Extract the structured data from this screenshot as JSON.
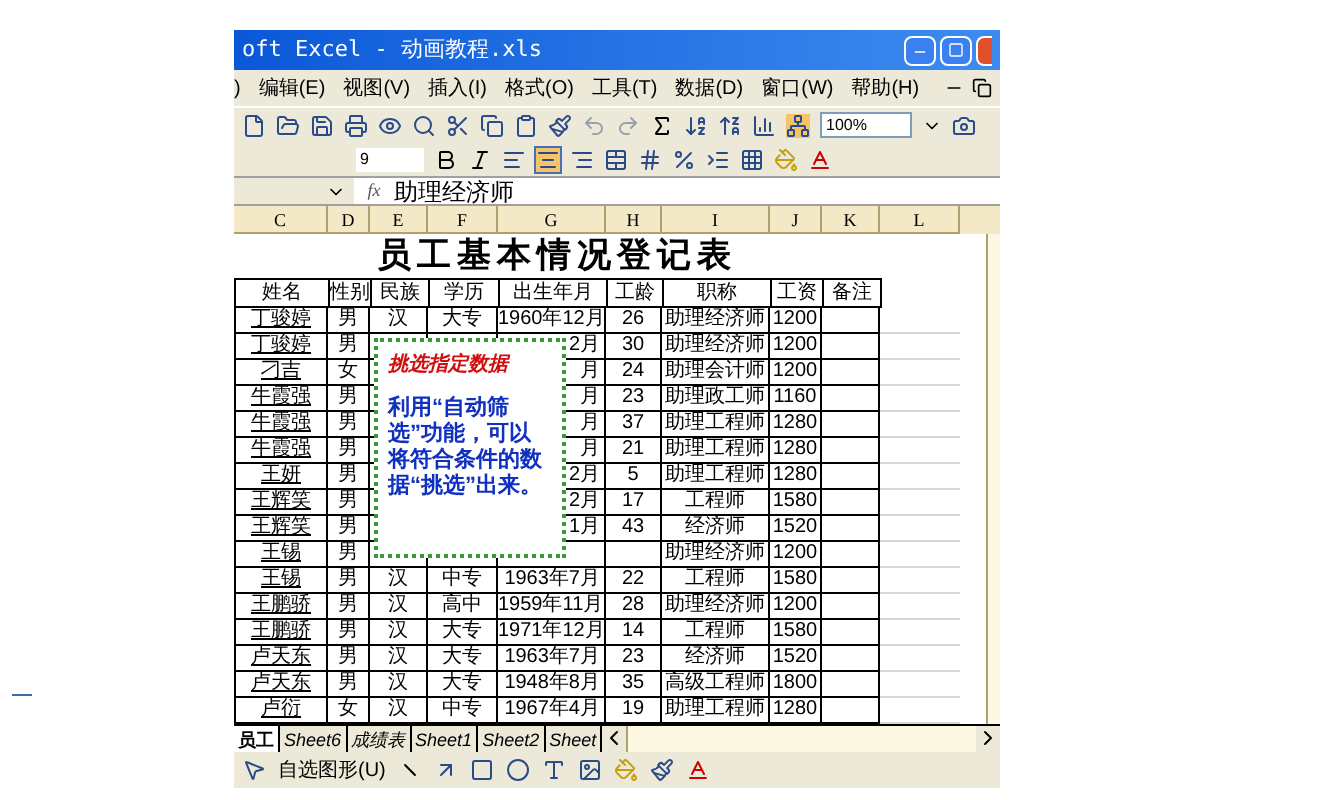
{
  "window": {
    "title": "oft Excel - 动画教程.xls"
  },
  "menu": [
    ")",
    "编辑(E)",
    "视图(V)",
    "插入(I)",
    "格式(O)",
    "工具(T)",
    "数据(D)",
    "窗口(W)",
    "帮助(H)"
  ],
  "toolbar": {
    "zoom": "100%"
  },
  "format_toolbar": {
    "font_size": "9",
    "align_buttons": [
      {
        "selected": false
      },
      {
        "selected": true
      },
      {
        "selected": false
      }
    ]
  },
  "formula_bar": {
    "fx": "fx",
    "value": "助理经济师"
  },
  "columns": [
    "C",
    "D",
    "E",
    "F",
    "G",
    "H",
    "I",
    "J",
    "K",
    "L"
  ],
  "sheet": {
    "title": "员工基本情况登记表",
    "headers": [
      "姓名",
      "性别",
      "民族",
      "学历",
      "出生年月",
      "工龄",
      "职称",
      "工资",
      "备注"
    ],
    "rows": [
      {
        "cells": [
          "丁骏婷",
          "男",
          "汉",
          "大专",
          "1960年12月",
          "26",
          "助理经济师",
          "1200"
        ]
      },
      {
        "cells": [
          "丁骏婷",
          "男",
          null,
          null,
          "2月",
          "30",
          "助理经济师",
          "1200"
        ]
      },
      {
        "cells": [
          "刁吉",
          "女",
          null,
          null,
          "月",
          "24",
          "助理会计师",
          "1200"
        ]
      },
      {
        "cells": [
          "牛霞强",
          "男",
          null,
          null,
          "月",
          "23",
          "助理政工师",
          "1160"
        ]
      },
      {
        "cells": [
          "牛霞强",
          "男",
          null,
          null,
          "月",
          "37",
          "助理工程师",
          "1280"
        ]
      },
      {
        "cells": [
          "牛霞强",
          "男",
          null,
          null,
          "月",
          "21",
          "助理工程师",
          "1280"
        ]
      },
      {
        "cells": [
          "王妍",
          "男",
          null,
          null,
          "2月",
          "5",
          "助理工程师",
          "1280"
        ]
      },
      {
        "cells": [
          "王辉笑",
          "男",
          null,
          null,
          "2月",
          "17",
          "工程师",
          "1580"
        ]
      },
      {
        "cells": [
          "王辉笑",
          "男",
          null,
          null,
          "1月",
          "43",
          "经济师",
          "1520"
        ]
      },
      {
        "cells": [
          "王锡",
          "男",
          null,
          null,
          null,
          null,
          "助理经济师",
          "1200"
        ]
      },
      {
        "cells": [
          "王锡",
          "男",
          "汉",
          "中专",
          "1963年7月",
          "22",
          "工程师",
          "1580"
        ]
      },
      {
        "cells": [
          "王鹏骄",
          "男",
          "汉",
          "高中",
          "1959年11月",
          "28",
          "助理经济师",
          "1200"
        ]
      },
      {
        "cells": [
          "王鹏骄",
          "男",
          "汉",
          "大专",
          "1971年12月",
          "14",
          "工程师",
          "1580"
        ]
      },
      {
        "cells": [
          "卢天东",
          "男",
          "汉",
          "大专",
          "1963年7月",
          "23",
          "经济师",
          "1520"
        ]
      },
      {
        "cells": [
          "卢天东",
          "男",
          "汉",
          "大专",
          "1948年8月",
          "35",
          "高级工程师",
          "1800"
        ]
      },
      {
        "cells": [
          "卢衍",
          "女",
          "汉",
          "中专",
          "1967年4月",
          "19",
          "助理工程师",
          "1280"
        ]
      }
    ]
  },
  "callout": {
    "title": "挑选指定数据",
    "body": "利用“自动筛选”功能，可以将符合条件的数据“挑选”出来。"
  },
  "sheet_tabs": [
    {
      "label": "员工",
      "selected": true
    },
    {
      "label": "Sheet6",
      "selected": false
    },
    {
      "label": "成绩表",
      "selected": false
    },
    {
      "label": "Sheet1",
      "selected": false
    },
    {
      "label": "Sheet2",
      "selected": false
    },
    {
      "label": "Sheet",
      "selected": false
    }
  ],
  "drawing_toolbar": {
    "label": "自选图形(U)"
  }
}
